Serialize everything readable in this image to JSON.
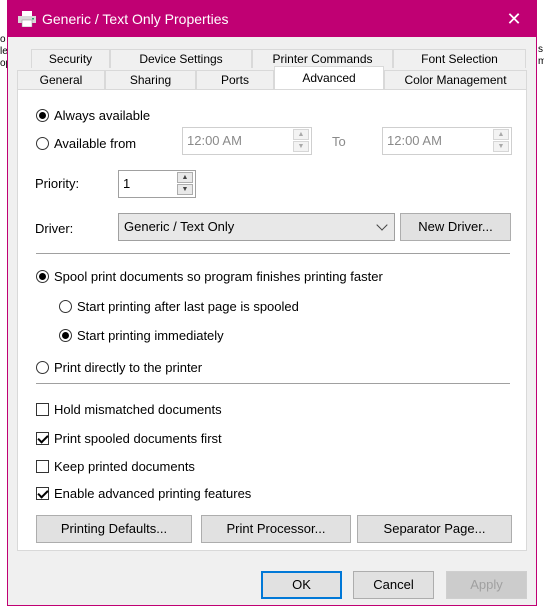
{
  "window": {
    "title": "Generic / Text Only Properties",
    "close_glyph": "✕"
  },
  "tabs": {
    "row1": [
      "Security",
      "Device Settings",
      "Printer Commands",
      "Font Selection"
    ],
    "row2": [
      "General",
      "Sharing",
      "Ports",
      "Advanced",
      "Color Management"
    ],
    "active": "Advanced"
  },
  "availability": {
    "always_label": "Always available",
    "from_label": "Available from",
    "from_time": "12:00 AM",
    "to_label": "To",
    "to_time": "12:00 AM",
    "selected": "always"
  },
  "priority": {
    "label": "Priority:",
    "value": "1"
  },
  "driver": {
    "label": "Driver:",
    "selected": "Generic / Text Only",
    "new_driver_button": "New Driver..."
  },
  "spooling": {
    "spool_label": "Spool print documents so program finishes printing faster",
    "after_last_label": "Start printing after last page is spooled",
    "immediately_label": "Start printing immediately",
    "direct_label": "Print directly to the printer",
    "selected_mode": "spool",
    "selected_start": "immediately"
  },
  "options": [
    {
      "label": "Hold mismatched documents",
      "checked": false
    },
    {
      "label": "Print spooled documents first",
      "checked": true
    },
    {
      "label": "Keep printed documents",
      "checked": false
    },
    {
      "label": "Enable advanced printing features",
      "checked": true
    }
  ],
  "bottom_buttons": {
    "printing_defaults": "Printing Defaults...",
    "print_processor": "Print Processor...",
    "separator_page": "Separator Page..."
  },
  "dialog_buttons": {
    "ok": "OK",
    "cancel": "Cancel",
    "apply": "Apply"
  },
  "colors": {
    "titlebar": "#c00073",
    "accent": "#0078d7"
  },
  "background_fragments": [
    "o",
    "le",
    "op",
    "s",
    "m"
  ]
}
